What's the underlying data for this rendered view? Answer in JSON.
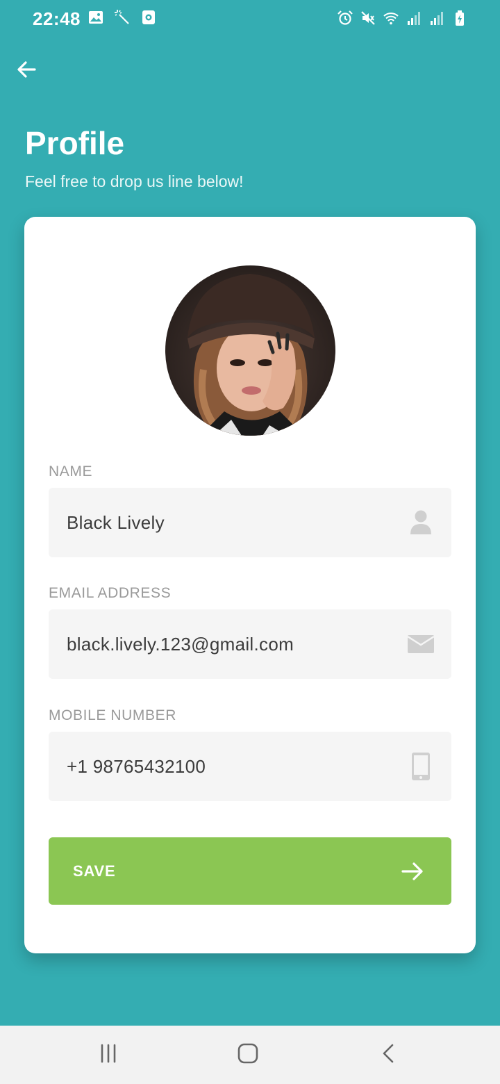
{
  "status_bar": {
    "time": "22:48",
    "left_icons": [
      "gallery-icon",
      "magic-wand-icon",
      "screen-record-icon"
    ],
    "right_icons": [
      "alarm-icon",
      "mute-icon",
      "wifi-icon",
      "signal-icon",
      "signal-icon",
      "battery-charging-icon"
    ]
  },
  "header": {
    "title": "Profile",
    "subtitle": "Feel free to drop us line below!"
  },
  "profile": {
    "avatar": "profile-photo",
    "fields": {
      "name": {
        "label": "NAME",
        "value": "Black Lively",
        "icon": "user-icon"
      },
      "email": {
        "label": "EMAIL ADDRESS",
        "value": "black.lively.123@gmail.com",
        "icon": "mail-icon"
      },
      "mobile": {
        "label": "MOBILE NUMBER",
        "value": "+1 98765432100",
        "icon": "phone-icon"
      }
    },
    "save_button": {
      "label": "SAVE",
      "icon": "arrow-right-icon"
    }
  },
  "nav_bar": {
    "buttons": [
      "recents-icon",
      "home-icon",
      "back-nav-icon"
    ]
  },
  "colors": {
    "background": "#34adb2",
    "card": "#ffffff",
    "field": "#f5f5f5",
    "accent": "#8bc653",
    "label": "#9a9a9a",
    "text": "#3c3c3c"
  }
}
